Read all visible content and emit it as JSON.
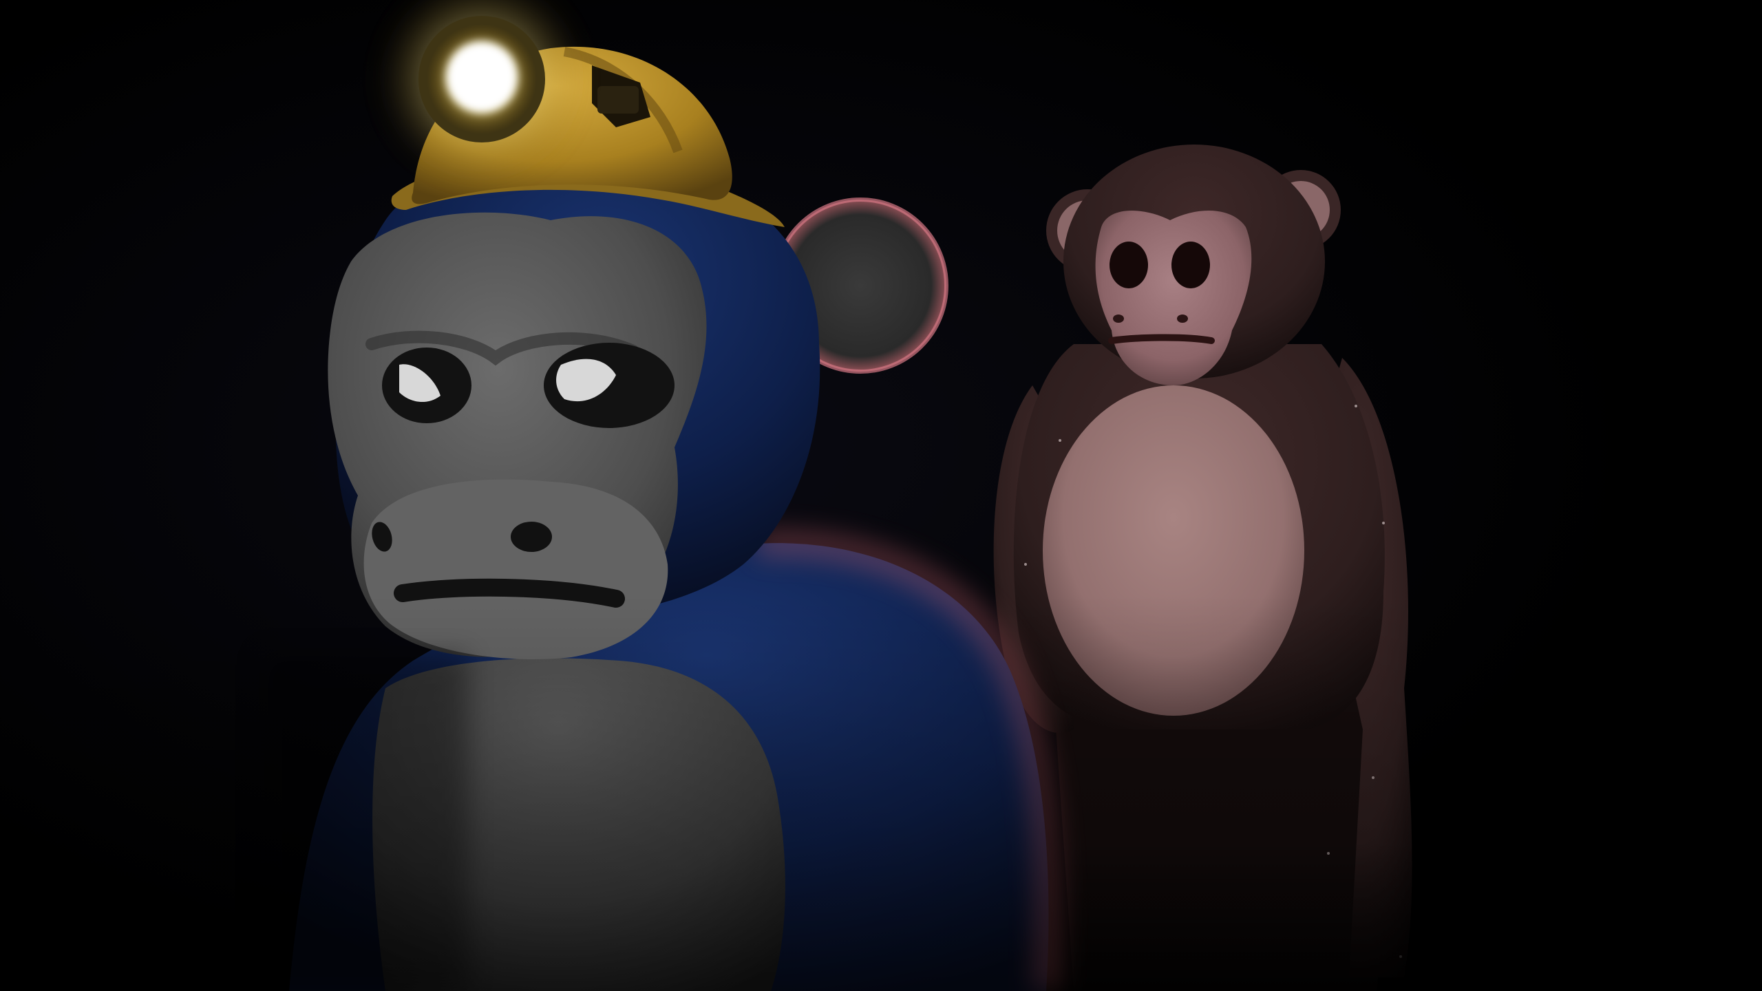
{
  "scene": {
    "background_color": "#000000",
    "characters": [
      {
        "id": "miner-gorilla",
        "fur_color": "#0e1f4a",
        "face_color": "#5a5a5a",
        "chest_color": "#4a4a4a",
        "rim_light_color": "#c8646e",
        "accessory": "hard-hat-with-headlamp",
        "helmet_color": "#b8902e",
        "headlamp_color": "#fff6c8"
      },
      {
        "id": "background-monkey",
        "fur_color": "#2e1e1e",
        "face_color": "#9a7276",
        "chest_color": "#93706f",
        "ear_color": "#8a6768"
      }
    ]
  }
}
